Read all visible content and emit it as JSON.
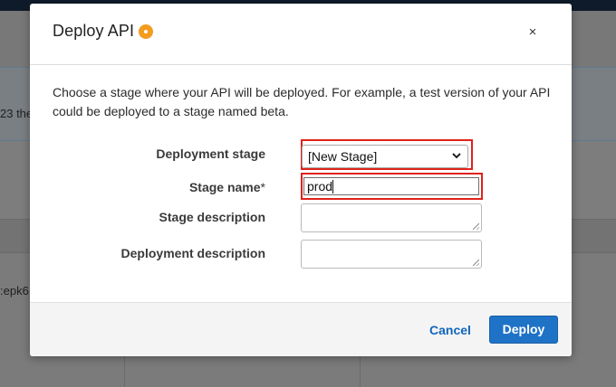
{
  "background": {
    "fragment_left_1": "23 the",
    "fragment_left_2": ":epk6"
  },
  "dialog": {
    "title": "Deploy API",
    "close_symbol": "×",
    "intro": "Choose a stage where your API will be deployed. For example, a test version of your API could be deployed to a stage named beta.",
    "fields": {
      "deployment_stage": {
        "label": "Deployment stage",
        "value": "[New Stage]"
      },
      "stage_name": {
        "label": "Stage name",
        "required_mark": "*",
        "value": "prod"
      },
      "stage_description": {
        "label": "Stage description",
        "value": ""
      },
      "deployment_description": {
        "label": "Deployment description",
        "value": ""
      }
    },
    "footer": {
      "cancel_label": "Cancel",
      "deploy_label": "Deploy"
    }
  },
  "colors": {
    "accent": "#1f73c6",
    "link": "#1166bb",
    "highlight": "#e0221a",
    "info_icon": "#f39c1f"
  }
}
